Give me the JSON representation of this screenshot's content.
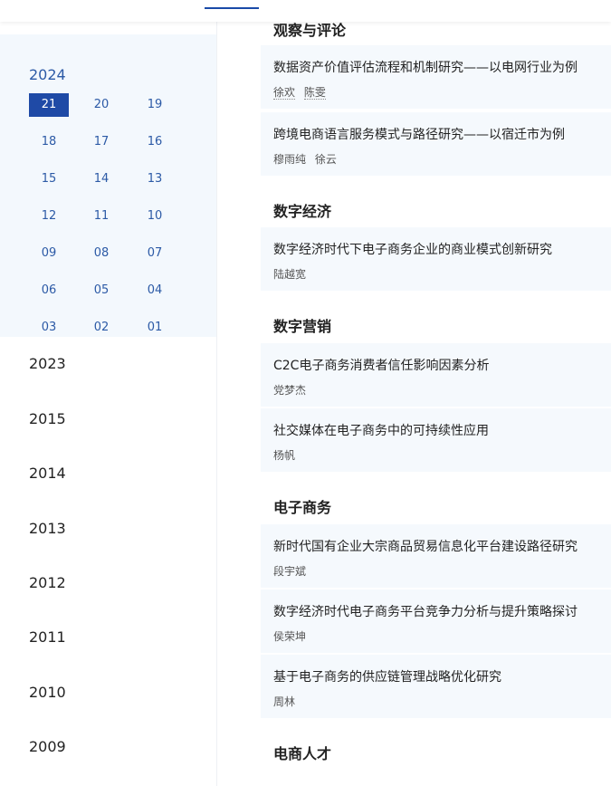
{
  "sidebar": {
    "active_year": "2024",
    "issues": [
      "21",
      "20",
      "19",
      "18",
      "17",
      "16",
      "15",
      "14",
      "13",
      "12",
      "11",
      "10",
      "09",
      "08",
      "07",
      "06",
      "05",
      "04",
      "03",
      "02",
      "01"
    ],
    "active_issue": "21",
    "years": [
      "2023",
      "2015",
      "2014",
      "2013",
      "2012",
      "2011",
      "2010",
      "2009"
    ]
  },
  "content": {
    "sections": [
      {
        "title": "观察与评论",
        "articles": [
          {
            "title": "数据资产价值评估流程和机制研究——以电网行业为例",
            "authors": [
              "徐欢",
              "陈雯"
            ]
          },
          {
            "title": "跨境电商语言服务模式与路径研究——以宿迁市为例",
            "authors": [
              "穆雨纯",
              "徐云"
            ]
          }
        ]
      },
      {
        "title": "数字经济",
        "articles": [
          {
            "title": "数字经济时代下电子商务企业的商业模式创新研究",
            "authors": [
              "陆越宽"
            ]
          }
        ]
      },
      {
        "title": "数字营销",
        "articles": [
          {
            "title": "C2C电子商务消费者信任影响因素分析",
            "authors": [
              "党梦杰"
            ]
          },
          {
            "title": "社交媒体在电子商务中的可持续性应用",
            "authors": [
              "杨帆"
            ]
          }
        ]
      },
      {
        "title": "电子商务",
        "articles": [
          {
            "title": "新时代国有企业大宗商品贸易信息化平台建设路径研究",
            "authors": [
              "段宇斌"
            ]
          },
          {
            "title": "数字经济时代电子商务平台竞争力分析与提升策略探讨",
            "authors": [
              "侯荣坤"
            ]
          },
          {
            "title": "基于电子商务的供应链管理战略优化研究",
            "authors": [
              "周林"
            ]
          }
        ]
      },
      {
        "title": "电商人才",
        "articles": []
      }
    ]
  }
}
